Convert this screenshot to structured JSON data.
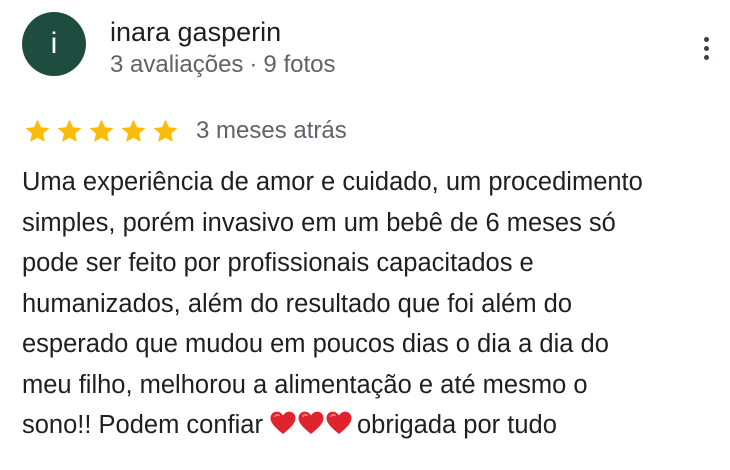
{
  "reviewer": {
    "avatar_letter": "i",
    "avatar_color": "#1e4d40",
    "name": "inara gasperin",
    "reviews_count": "3 avaliações",
    "photos_count": "9 fotos",
    "separator": "·"
  },
  "menu": {
    "icon": "more-vert-icon"
  },
  "review": {
    "rating": 5,
    "rating_max": 5,
    "star_color": "#fbbc04",
    "date": "3 meses atrás",
    "text_lines": [
      "Uma experiência de amor e cuidado, um procedimento",
      "simples, porém invasivo em um bebê de 6 meses só",
      "pode ser feito por profissionais capacitados e",
      "humanizados, além do resultado que foi além do",
      "esperado que mudou em poucos dias o dia a dia do",
      "meu filho, melhorou a alimentação e até mesmo o"
    ],
    "last_line_before": "sono!! Podem confiar",
    "hearts": "❤️❤️❤️",
    "last_line_after": "obrigada por tudo"
  }
}
